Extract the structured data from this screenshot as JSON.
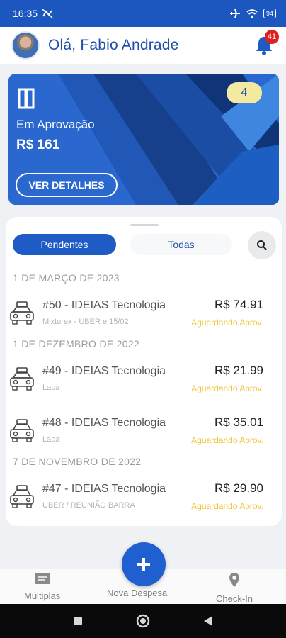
{
  "status_bar": {
    "time": "16:35",
    "battery": "94"
  },
  "header": {
    "greeting": "Olá, Fabio Andrade",
    "notification_count": "41"
  },
  "hero": {
    "label": "Em Aprovação",
    "amount": "R$ 161",
    "count": "4",
    "details_button": "VER DETALHES"
  },
  "tabs": {
    "pendentes": "Pendentes",
    "todas": "Todas"
  },
  "groups": [
    {
      "date": "1 DE MARÇO DE 2023",
      "items": [
        {
          "title": "#50 - IDEIAS Tecnologia",
          "subtitle": "Mixturex - UBER e 15/02",
          "amount": "R$ 74.91",
          "status": "Aguardando Aprov."
        }
      ]
    },
    {
      "date": "1 DE DEZEMBRO DE 2022",
      "items": [
        {
          "title": "#49 - IDEIAS Tecnologia",
          "subtitle": "Lapa",
          "amount": "R$ 21.99",
          "status": "Aguardando Aprov."
        },
        {
          "title": "#48 - IDEIAS Tecnologia",
          "subtitle": "Lapa",
          "amount": "R$ 35.01",
          "status": "Aguardando Aprov."
        }
      ]
    },
    {
      "date": "7 DE NOVEMBRO DE 2022",
      "items": [
        {
          "title": "#47 - IDEIAS Tecnologia",
          "subtitle": "UBER / REUNIÃO BARRA",
          "amount": "R$ 29.90",
          "status": "Aguardando Aprov."
        }
      ]
    }
  ],
  "bottom_nav": {
    "multiplas": "Múltiplas",
    "nova_despesa": "Nova Despesa",
    "checkin": "Check-In"
  },
  "colors": {
    "primary": "#1f5bc4",
    "status_pending": "#f0c53a",
    "badge": "#e02020"
  }
}
